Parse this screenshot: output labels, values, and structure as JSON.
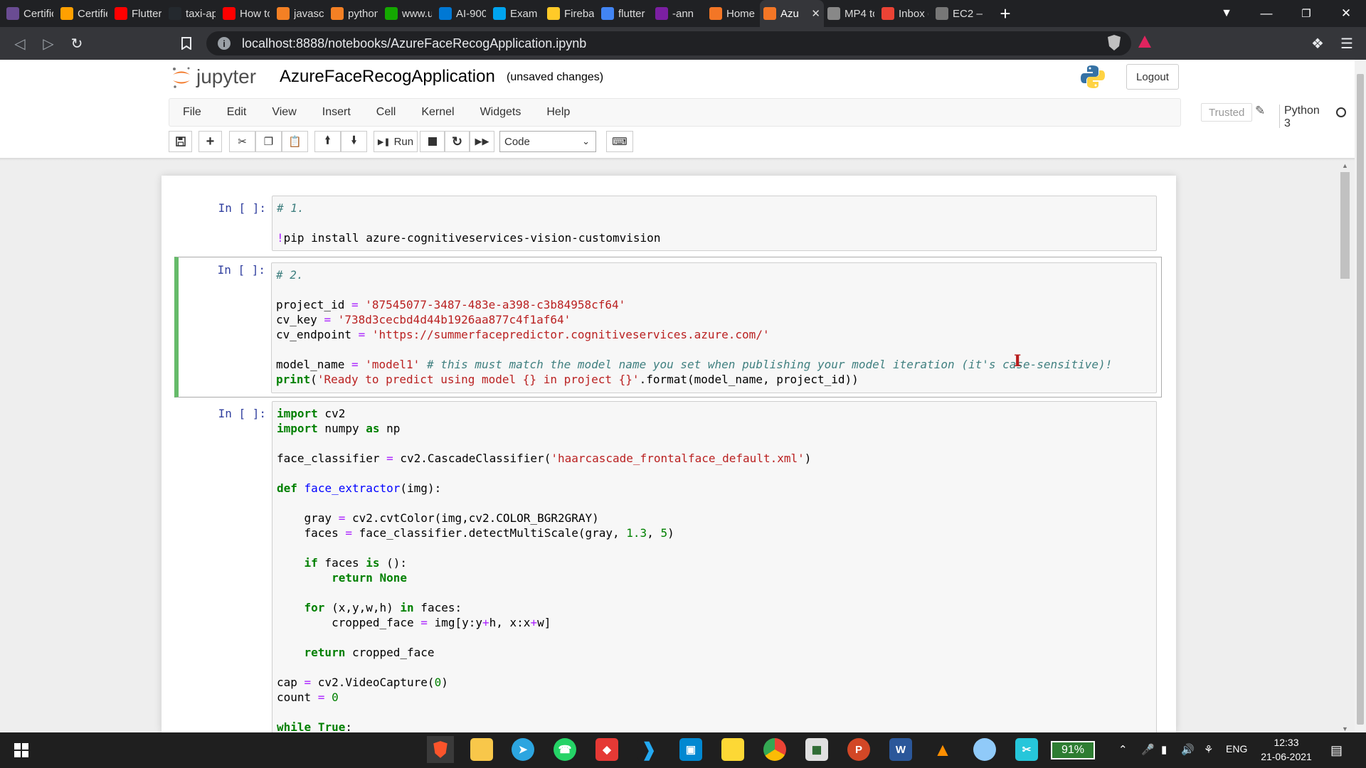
{
  "browser": {
    "tabs": [
      {
        "label": "Certific",
        "icon": "mstr-icon",
        "color": "#6a4c93"
      },
      {
        "label": "Certifie",
        "icon": "firebase-icon",
        "color": "#ffa000"
      },
      {
        "label": "Flutter",
        "icon": "youtube-icon",
        "color": "#ff0000"
      },
      {
        "label": "taxi-ap",
        "icon": "github-icon",
        "color": "#24292e"
      },
      {
        "label": "How to",
        "icon": "youtube-icon",
        "color": "#ff0000"
      },
      {
        "label": "javascri",
        "icon": "stackoverflow-icon",
        "color": "#f48024"
      },
      {
        "label": "python",
        "icon": "stackoverflow-icon",
        "color": "#f48024"
      },
      {
        "label": "www.u",
        "icon": "upwork-icon",
        "color": "#14a800"
      },
      {
        "label": "AI-900",
        "icon": "docs-icon",
        "color": "#0078d4"
      },
      {
        "label": "Exam A",
        "icon": "microsoft-icon",
        "color": "#00a4ef"
      },
      {
        "label": "Firebas",
        "icon": "firebase-icon",
        "color": "#ffca28"
      },
      {
        "label": "flutter",
        "icon": "google-icon",
        "color": "#4285f4"
      },
      {
        "label": "-ann",
        "icon": "pointer-icon",
        "color": "#7b1fa2"
      },
      {
        "label": "Home",
        "icon": "jupyter-icon",
        "color": "#f37626"
      },
      {
        "label": "Azu",
        "icon": "jupyter-icon",
        "color": "#f37626",
        "active": true
      },
      {
        "label": "MP4 to",
        "icon": "cloud-icon",
        "color": "#888888"
      },
      {
        "label": "Inbox (",
        "icon": "gmail-icon",
        "color": "#ea4335"
      },
      {
        "label": "EC2 —",
        "icon": "globe-icon",
        "color": "#777777"
      }
    ],
    "url": "localhost:8888/notebooks/AzureFaceRecogApplication.ipynb"
  },
  "header": {
    "logo_text": "jupyter",
    "notebook_title": "AzureFaceRecogApplication",
    "status": "(unsaved changes)",
    "logout_label": "Logout"
  },
  "menu": {
    "items": [
      "File",
      "Edit",
      "View",
      "Insert",
      "Cell",
      "Kernel",
      "Widgets",
      "Help"
    ],
    "trusted_label": "Trusted",
    "kernel_name": "Python 3"
  },
  "toolbar": {
    "run_label": "Run",
    "cell_type": "Code"
  },
  "cells": [
    {
      "prompt": "In [ ]:"
    },
    {
      "prompt": "In [ ]:"
    },
    {
      "prompt": "In [ ]:"
    }
  ],
  "taskbar": {
    "battery": "91%",
    "language": "ENG",
    "time": "12:33",
    "date": "21-06-2021"
  }
}
